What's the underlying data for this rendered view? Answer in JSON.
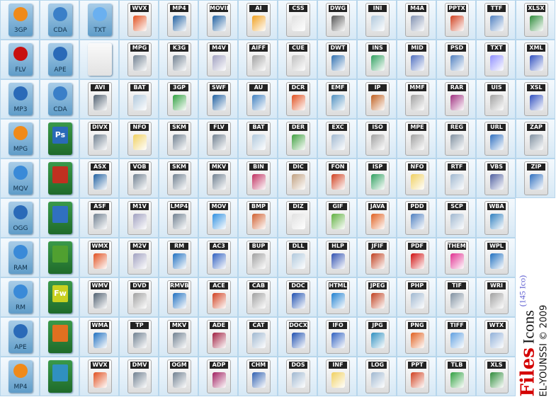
{
  "rows": [
    [
      {
        "l": "3GP",
        "k": "doc",
        "c": "#f08a1a"
      },
      {
        "l": "CDA",
        "k": "doc",
        "c": "#3a7fc8"
      },
      {
        "l": "TXT",
        "k": "doc",
        "c": "#6ab0f0"
      },
      {
        "l": "WVX",
        "k": "s",
        "c": "#e05020"
      },
      {
        "l": "MP4",
        "k": "s",
        "c": "#2060a0"
      },
      {
        "l": "MOVIE",
        "k": "s",
        "c": "#2060a0"
      },
      {
        "l": "AI",
        "k": "s",
        "c": "#f0a020"
      },
      {
        "l": "CSS",
        "k": "s",
        "c": "#e0e0e0"
      },
      {
        "l": "DWG",
        "k": "s",
        "c": "#555555"
      },
      {
        "l": "INI",
        "k": "s",
        "c": "#b0c8dc"
      },
      {
        "l": "M4A",
        "k": "s",
        "c": "#8090b0"
      },
      {
        "l": "PPTX",
        "k": "s",
        "c": "#d04020"
      },
      {
        "l": "TTF",
        "k": "s",
        "c": "#5080c0"
      },
      {
        "l": "XLSX",
        "k": "s",
        "c": "#2e8b3a"
      }
    ],
    [
      {
        "l": "FLV",
        "k": "doc",
        "c": "#c81010"
      },
      {
        "l": "APE",
        "k": "doc",
        "c": "#2a6ab8"
      },
      {
        "l": "",
        "k": "blank",
        "c": "#eeeeee"
      },
      {
        "l": "MPG",
        "k": "s",
        "c": "#708090"
      },
      {
        "l": "K3G",
        "k": "s",
        "c": "#708090"
      },
      {
        "l": "M4V",
        "k": "s",
        "c": "#a0a0c0"
      },
      {
        "l": "AIFF",
        "k": "s",
        "c": "#a0a0a0"
      },
      {
        "l": "CUE",
        "k": "s",
        "c": "#c0c0c0"
      },
      {
        "l": "DWT",
        "k": "s",
        "c": "#3070b0"
      },
      {
        "l": "INS",
        "k": "s",
        "c": "#30a060"
      },
      {
        "l": "MID",
        "k": "s",
        "c": "#5070c0"
      },
      {
        "l": "PSD",
        "k": "s",
        "c": "#5080c0"
      },
      {
        "l": "TXT",
        "k": "s",
        "c": "#9090ff"
      },
      {
        "l": "XML",
        "k": "s",
        "c": "#3050c0"
      }
    ],
    [
      {
        "l": "MP3",
        "k": "doc",
        "c": "#2a6ab8"
      },
      {
        "l": "CDA",
        "k": "doc",
        "c": "#3a7fc8"
      },
      {
        "l": "AVI",
        "k": "s",
        "c": "#506070"
      },
      {
        "l": "BAT",
        "k": "s",
        "c": "#b0c8dc"
      },
      {
        "l": "3GP",
        "k": "s",
        "c": "#30a040"
      },
      {
        "l": "SWF",
        "k": "s",
        "c": "#2060a0"
      },
      {
        "l": "AU",
        "k": "s",
        "c": "#4080c0"
      },
      {
        "l": "DCR",
        "k": "s",
        "c": "#e05020"
      },
      {
        "l": "EMF",
        "k": "s",
        "c": "#5090c0"
      },
      {
        "l": "IP",
        "k": "s",
        "c": "#c06020"
      },
      {
        "l": "MMF",
        "k": "s",
        "c": "#a0a0a0"
      },
      {
        "l": "RAR",
        "k": "s",
        "c": "#a03080"
      },
      {
        "l": "UIS",
        "k": "s",
        "c": "#a0a0a0"
      },
      {
        "l": "XSL",
        "k": "s",
        "c": "#3050c0"
      }
    ],
    [
      {
        "l": "MPG",
        "k": "doc",
        "c": "#f08a1a"
      },
      {
        "l": "Ps",
        "k": "gdoc",
        "c": "#2a6ab8"
      },
      {
        "l": "DIVX",
        "k": "s",
        "c": "#708090"
      },
      {
        "l": "NFO",
        "k": "s",
        "c": "#f0d060"
      },
      {
        "l": "SKM",
        "k": "s",
        "c": "#708090"
      },
      {
        "l": "FLV",
        "k": "s",
        "c": "#708090"
      },
      {
        "l": "BAT",
        "k": "s",
        "c": "#b0c8dc"
      },
      {
        "l": "DER",
        "k": "s",
        "c": "#40a040"
      },
      {
        "l": "EXC",
        "k": "s",
        "c": "#a0b8d0"
      },
      {
        "l": "ISO",
        "k": "s",
        "c": "#a0a0a0"
      },
      {
        "l": "MPE",
        "k": "s",
        "c": "#a0a0a0"
      },
      {
        "l": "REG",
        "k": "s",
        "c": "#8090a0"
      },
      {
        "l": "URL",
        "k": "s",
        "c": "#3070c0"
      },
      {
        "l": "ZAP",
        "k": "s",
        "c": "#8090a0"
      }
    ],
    [
      {
        "l": "MQV",
        "k": "doc",
        "c": "#3a8ad8"
      },
      {
        "l": "",
        "k": "gdoc",
        "c": "#c03020"
      },
      {
        "l": "ASX",
        "k": "s",
        "c": "#2060a0"
      },
      {
        "l": "VOB",
        "k": "s",
        "c": "#708090"
      },
      {
        "l": "SKM",
        "k": "s",
        "c": "#708090"
      },
      {
        "l": "MKV",
        "k": "s",
        "c": "#708090"
      },
      {
        "l": "BIN",
        "k": "s",
        "c": "#c03060"
      },
      {
        "l": "DIC",
        "k": "s",
        "c": "#c0a080"
      },
      {
        "l": "FON",
        "k": "s",
        "c": "#d04020"
      },
      {
        "l": "ISP",
        "k": "s",
        "c": "#30a060"
      },
      {
        "l": "NFO",
        "k": "s",
        "c": "#f0d060"
      },
      {
        "l": "RTF",
        "k": "s",
        "c": "#a0b8d0"
      },
      {
        "l": "VBS",
        "k": "s",
        "c": "#5060a0"
      },
      {
        "l": "ZIP",
        "k": "s",
        "c": "#3070c0"
      }
    ],
    [
      {
        "l": "OGG",
        "k": "doc",
        "c": "#2a6ab8"
      },
      {
        "l": "",
        "k": "gdoc",
        "c": "#3070c0"
      },
      {
        "l": "ASF",
        "k": "s",
        "c": "#708090"
      },
      {
        "l": "M1V",
        "k": "s",
        "c": "#a0a0c0"
      },
      {
        "l": "LMP4",
        "k": "s",
        "c": "#708090"
      },
      {
        "l": "MOV",
        "k": "s",
        "c": "#3090e0"
      },
      {
        "l": "BMP",
        "k": "s",
        "c": "#d06030"
      },
      {
        "l": "DIZ",
        "k": "s",
        "c": "#e0e0e0"
      },
      {
        "l": "GIF",
        "k": "s",
        "c": "#60b040"
      },
      {
        "l": "JAVA",
        "k": "s",
        "c": "#e06020"
      },
      {
        "l": "PDD",
        "k": "s",
        "c": "#5080c0"
      },
      {
        "l": "SCP",
        "k": "s",
        "c": "#a0b8d0"
      },
      {
        "l": "WBA",
        "k": "s",
        "c": "#3080c0"
      }
    ],
    [
      {
        "l": "RAM",
        "k": "doc",
        "c": "#3a8ad8"
      },
      {
        "l": "",
        "k": "gdoc",
        "c": "#50a030"
      },
      {
        "l": "WMX",
        "k": "s",
        "c": "#e05020"
      },
      {
        "l": "M2V",
        "k": "s",
        "c": "#a0a0c0"
      },
      {
        "l": "RM",
        "k": "s",
        "c": "#2070c0"
      },
      {
        "l": "AC3",
        "k": "s",
        "c": "#3060c0"
      },
      {
        "l": "BUP",
        "k": "s",
        "c": "#a0a0a0"
      },
      {
        "l": "DLL",
        "k": "s",
        "c": "#b0c8dc"
      },
      {
        "l": "HLP",
        "k": "s",
        "c": "#3050b0"
      },
      {
        "l": "JFIF",
        "k": "s",
        "c": "#c04020"
      },
      {
        "l": "PDF",
        "k": "s",
        "c": "#d01010"
      },
      {
        "l": "THEME",
        "k": "s",
        "c": "#e03090"
      },
      {
        "l": "WPL",
        "k": "s",
        "c": "#2070c0"
      }
    ],
    [
      {
        "l": "RM",
        "k": "doc",
        "c": "#3a8ad8"
      },
      {
        "l": "Fw",
        "k": "gdoc",
        "c": "#c8d020"
      },
      {
        "l": "WMV",
        "k": "s",
        "c": "#506070"
      },
      {
        "l": "DVD",
        "k": "s",
        "c": "#a0a0a0"
      },
      {
        "l": "RMVB",
        "k": "s",
        "c": "#2070c0"
      },
      {
        "l": "ACE",
        "k": "s",
        "c": "#d04020"
      },
      {
        "l": "CAB",
        "k": "s",
        "c": "#a0a0a0"
      },
      {
        "l": "DOC",
        "k": "s",
        "c": "#2050b0"
      },
      {
        "l": "HTML",
        "k": "s",
        "c": "#2080d0"
      },
      {
        "l": "JPEG",
        "k": "s",
        "c": "#c04020"
      },
      {
        "l": "PHP",
        "k": "s",
        "c": "#a0b8d0"
      },
      {
        "l": "TIF",
        "k": "s",
        "c": "#8090a0"
      },
      {
        "l": "WRI",
        "k": "s",
        "c": "#a0a0a0"
      }
    ],
    [
      {
        "l": "APE",
        "k": "doc",
        "c": "#2a6ab8"
      },
      {
        "l": "",
        "k": "gdoc",
        "c": "#e07020"
      },
      {
        "l": "WMA",
        "k": "s",
        "c": "#2070c0"
      },
      {
        "l": "TP",
        "k": "s",
        "c": "#708090"
      },
      {
        "l": "MKV",
        "k": "s",
        "c": "#708090"
      },
      {
        "l": "ADE",
        "k": "s",
        "c": "#a02040"
      },
      {
        "l": "CAT",
        "k": "s",
        "c": "#a0b8d0"
      },
      {
        "l": "DOCX",
        "k": "s",
        "c": "#2050b0"
      },
      {
        "l": "IFO",
        "k": "s",
        "c": "#3060c0"
      },
      {
        "l": "JPG",
        "k": "s",
        "c": "#3090c0"
      },
      {
        "l": "PNG",
        "k": "s",
        "c": "#e06020"
      },
      {
        "l": "TIFF",
        "k": "s",
        "c": "#60a0e0"
      },
      {
        "l": "WTX",
        "k": "s",
        "c": "#90b0d8"
      }
    ],
    [
      {
        "l": "MP4",
        "k": "doc",
        "c": "#f08a1a"
      },
      {
        "l": "",
        "k": "gdoc",
        "c": "#3090c0"
      },
      {
        "l": "WVX",
        "k": "s",
        "c": "#e05020"
      },
      {
        "l": "DMV",
        "k": "s",
        "c": "#708090"
      },
      {
        "l": "OGM",
        "k": "s",
        "c": "#708090"
      },
      {
        "l": "ADP",
        "k": "s",
        "c": "#a02060"
      },
      {
        "l": "CHM",
        "k": "s",
        "c": "#3060b0"
      },
      {
        "l": "DOS",
        "k": "s",
        "c": "#a0b8d0"
      },
      {
        "l": "INF",
        "k": "s",
        "c": "#f0d060"
      },
      {
        "l": "LOG",
        "k": "s",
        "c": "#a0b8d0"
      },
      {
        "l": "PPT",
        "k": "s",
        "c": "#d04020"
      },
      {
        "l": "TLB",
        "k": "s",
        "c": "#30a040"
      },
      {
        "l": "XLS",
        "k": "s",
        "c": "#2e8b3a"
      }
    ]
  ],
  "credit": {
    "files": "Files",
    "icons": "Icons",
    "count": "(145 Ico)",
    "author": "EL-YOUNSSI © 2009"
  }
}
